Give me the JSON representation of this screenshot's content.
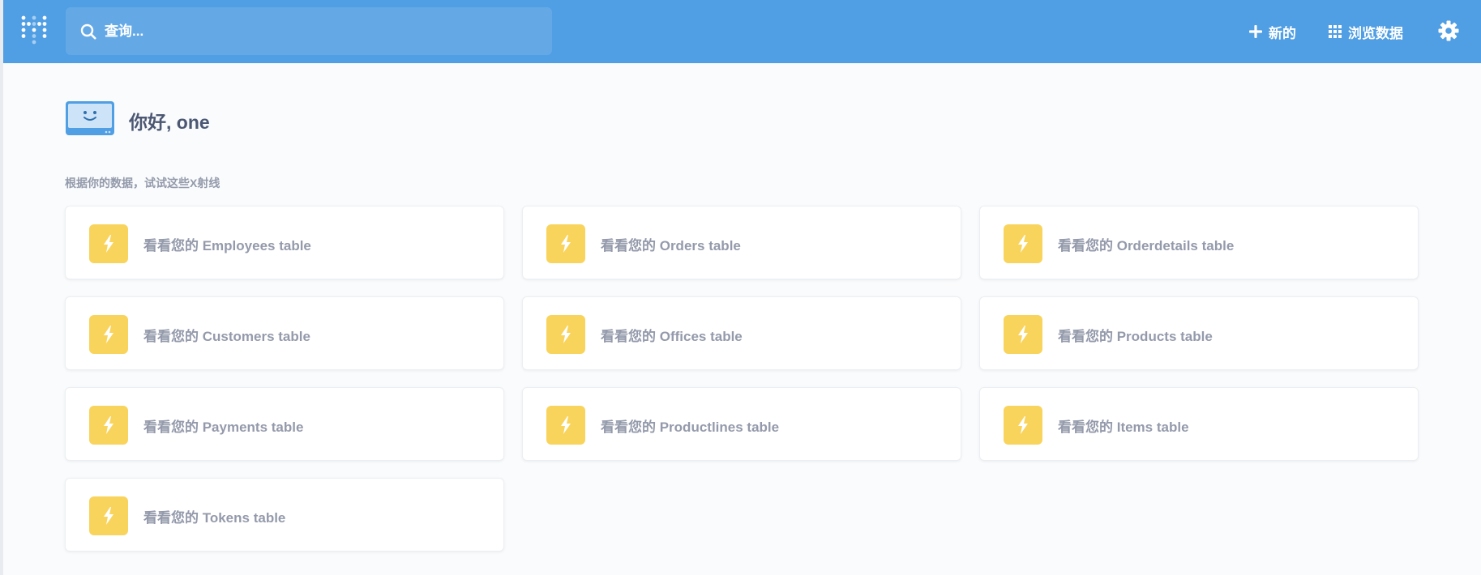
{
  "header": {
    "search_placeholder": "查询...",
    "new_label": "新的",
    "browse_label": "浏览数据",
    "brand_color": "#509ee3",
    "icons": {
      "logo": "metabase-logo-icon",
      "search": "search-icon",
      "new": "plus-icon",
      "browse": "grid-icon",
      "settings": "gear-icon"
    }
  },
  "greeting": {
    "text": "你好, one",
    "icon": "smiling-screen-icon"
  },
  "xrays": {
    "section_title": "根据你的数据，试试这些X射线",
    "accent_color": "#f9d45c",
    "icon": "lightning-bolt-icon",
    "items": [
      {
        "label": "看看您的 Employees table"
      },
      {
        "label": "看看您的 Orders table"
      },
      {
        "label": "看看您的 Orderdetails table"
      },
      {
        "label": "看看您的 Customers table"
      },
      {
        "label": "看看您的 Offices table"
      },
      {
        "label": "看看您的 Products table"
      },
      {
        "label": "看看您的 Payments table"
      },
      {
        "label": "看看您的 Productlines table"
      },
      {
        "label": "看看您的 Items table"
      },
      {
        "label": "看看您的 Tokens table"
      }
    ]
  }
}
